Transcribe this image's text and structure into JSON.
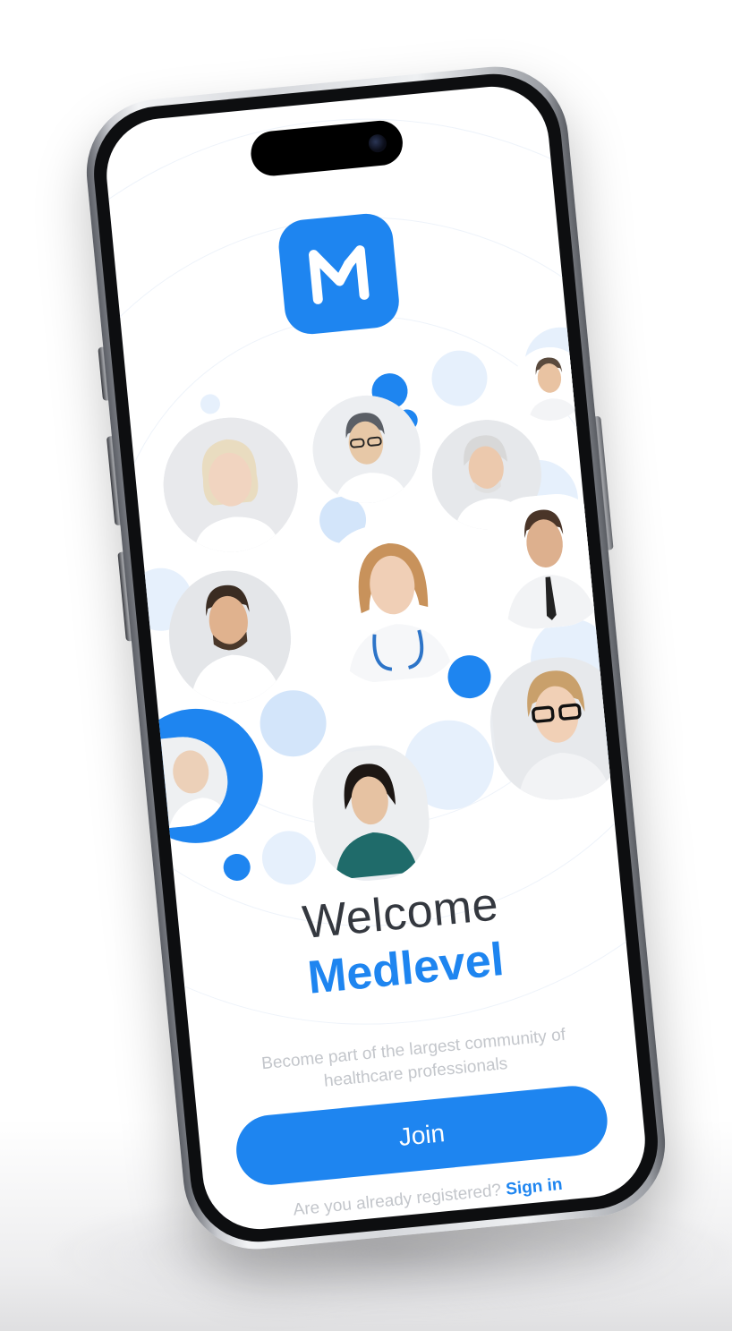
{
  "app": {
    "welcome_label": "Welcome",
    "brand_name": "Medlevel",
    "subtitle": "Become part of the largest community of healthcare professionals",
    "join_label": "Join",
    "signin_prompt": "Are you already registered?",
    "signin_label": "Sign in",
    "logo_icon": "medlevel-m-logo"
  },
  "colors": {
    "accent": "#1e85f0",
    "accent_light": "#e6f0fc",
    "text_dark": "#34383f",
    "text_muted": "#c3c6cb"
  }
}
